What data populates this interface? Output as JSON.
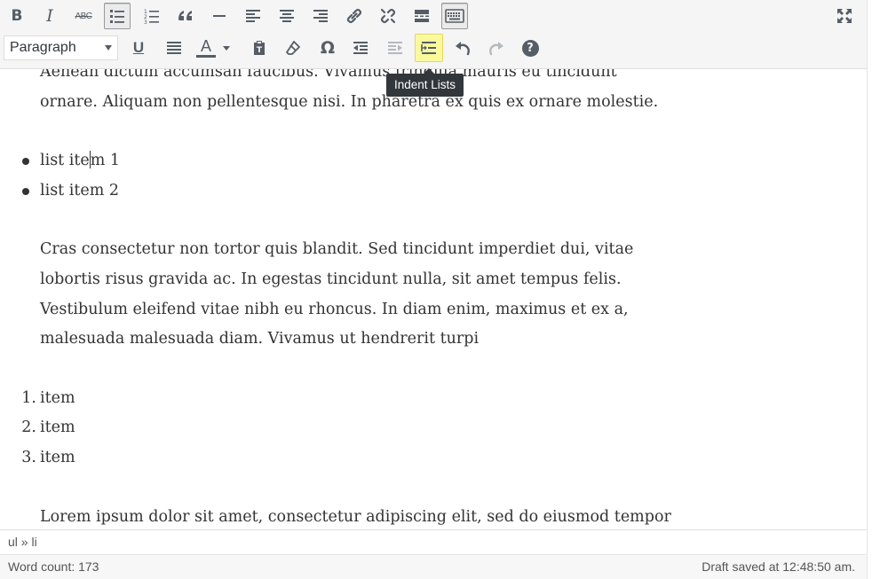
{
  "toolbar": {
    "row1": [
      {
        "name": "bold-button",
        "icon": "bold-icon",
        "label": "B"
      },
      {
        "name": "italic-button",
        "icon": "italic-icon",
        "label": "I"
      },
      {
        "name": "strikethrough-button",
        "icon": "strikethrough-icon",
        "label": "ABC"
      },
      {
        "name": "bulleted-list-button",
        "icon": "bulleted-list-icon",
        "active": true
      },
      {
        "name": "numbered-list-button",
        "icon": "numbered-list-icon"
      },
      {
        "name": "blockquote-button",
        "icon": "blockquote-icon"
      },
      {
        "name": "horizontal-line-button",
        "icon": "horizontal-line-icon"
      },
      {
        "name": "align-left-button",
        "icon": "align-left-icon"
      },
      {
        "name": "align-center-button",
        "icon": "align-center-icon"
      },
      {
        "name": "align-right-button",
        "icon": "align-right-icon"
      },
      {
        "name": "insert-link-button",
        "icon": "link-icon"
      },
      {
        "name": "remove-link-button",
        "icon": "unlink-icon"
      },
      {
        "name": "read-more-button",
        "icon": "read-more-icon"
      },
      {
        "name": "toolbar-toggle-button",
        "icon": "keyboard-icon",
        "active": true
      },
      {
        "name": "fullscreen-button",
        "icon": "fullscreen-icon"
      }
    ],
    "format_select": {
      "value": "Paragraph",
      "icon": "chevron-down-icon"
    },
    "row2": [
      {
        "name": "underline-button",
        "icon": "underline-icon",
        "label": "U"
      },
      {
        "name": "justify-button",
        "icon": "justify-icon"
      },
      {
        "name": "text-color-button",
        "icon": "text-color-icon",
        "label": "A"
      },
      {
        "name": "paste-as-text-button",
        "icon": "paste-text-icon"
      },
      {
        "name": "clear-formatting-button",
        "icon": "eraser-icon"
      },
      {
        "name": "special-character-button",
        "icon": "omega-icon",
        "label": "Ω"
      },
      {
        "name": "outdent-button",
        "icon": "outdent-icon"
      },
      {
        "name": "indent-button",
        "icon": "indent-icon",
        "disabled": true
      },
      {
        "name": "indent-lists-button",
        "icon": "indent-lists-icon",
        "hover": true
      },
      {
        "name": "undo-button",
        "icon": "undo-icon"
      },
      {
        "name": "redo-button",
        "icon": "redo-icon",
        "disabled": true
      },
      {
        "name": "help-button",
        "icon": "help-icon",
        "label": "?"
      }
    ]
  },
  "tooltip": {
    "text": "Indent Lists"
  },
  "content": {
    "paragraph1": {
      "line1": "Aenean dictum accumsan faucibus. Vivamus fringilla mauris eu tincidunt",
      "line2": "ornare. Aliquam non pellentesque nisi. In pharetra ex quis ex ornare molestie."
    },
    "bullet_list": [
      {
        "before_caret": "list ite",
        "after_caret": "m 1"
      },
      {
        "text": "list item 2"
      }
    ],
    "paragraph2": [
      "Cras consectetur non tortor quis blandit. Sed tincidunt imperdiet dui, vitae",
      "lobortis risus gravida ac. In egestas tincidunt nulla, sit amet tempus felis.",
      "Vestibulum eleifend vitae nibh eu rhoncus. In diam enim, maximus et ex a,",
      "malesuada malesuada diam. Vivamus ut hendrerit turpi"
    ],
    "ordered_list": [
      {
        "marker": "1.",
        "text": "item"
      },
      {
        "marker": "2.",
        "text": "item"
      },
      {
        "marker": "3.",
        "text": "item"
      }
    ],
    "paragraph3": [
      "Lorem ipsum dolor sit amet, consectetur adipiscing elit, sed do eiusmod tempor"
    ]
  },
  "statusbar": {
    "path": "ul » li"
  },
  "footer": {
    "word_count": "Word count: 173",
    "draft_saved": "Draft saved at 12:48:50 am."
  },
  "colors": {
    "toolbar_bg": "#f5f5f5",
    "icon": "#555d66",
    "icon_disabled": "#b4b9be",
    "hover_highlight": "#fafa9d",
    "tooltip_bg": "#32373c",
    "text": "#333333"
  }
}
